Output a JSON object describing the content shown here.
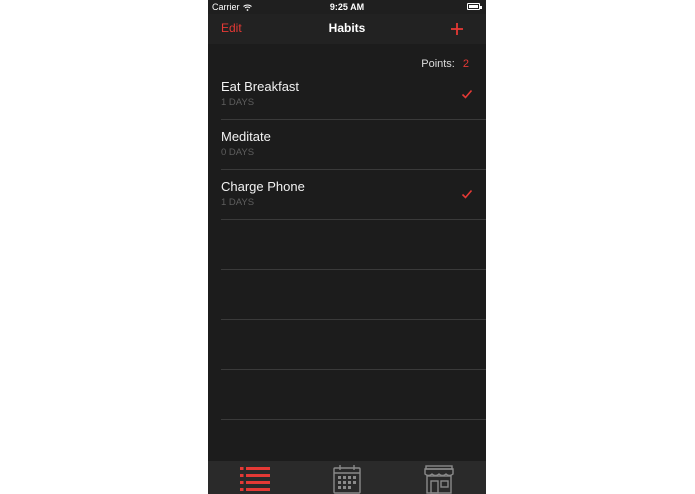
{
  "status_bar": {
    "carrier": "Carrier",
    "time": "9:25 AM"
  },
  "nav": {
    "edit_label": "Edit",
    "title": "Habits",
    "add_icon": "plus-icon"
  },
  "points": {
    "label": "Points:",
    "value": "2"
  },
  "habits": [
    {
      "name": "Eat Breakfast",
      "days": "1 DAYS",
      "checked": true
    },
    {
      "name": "Meditate",
      "days": "0 DAYS",
      "checked": false
    },
    {
      "name": "Charge Phone",
      "days": "1 DAYS",
      "checked": true
    }
  ],
  "empty_rows": 4,
  "tab_bar": {
    "tabs": [
      {
        "icon": "list-icon",
        "active": true
      },
      {
        "icon": "calendar-icon",
        "active": false
      },
      {
        "icon": "store-icon",
        "active": false
      }
    ]
  },
  "colors": {
    "accent": "#e53935",
    "background": "#1c1c1c",
    "inactive_icon": "#8a8a8a"
  }
}
